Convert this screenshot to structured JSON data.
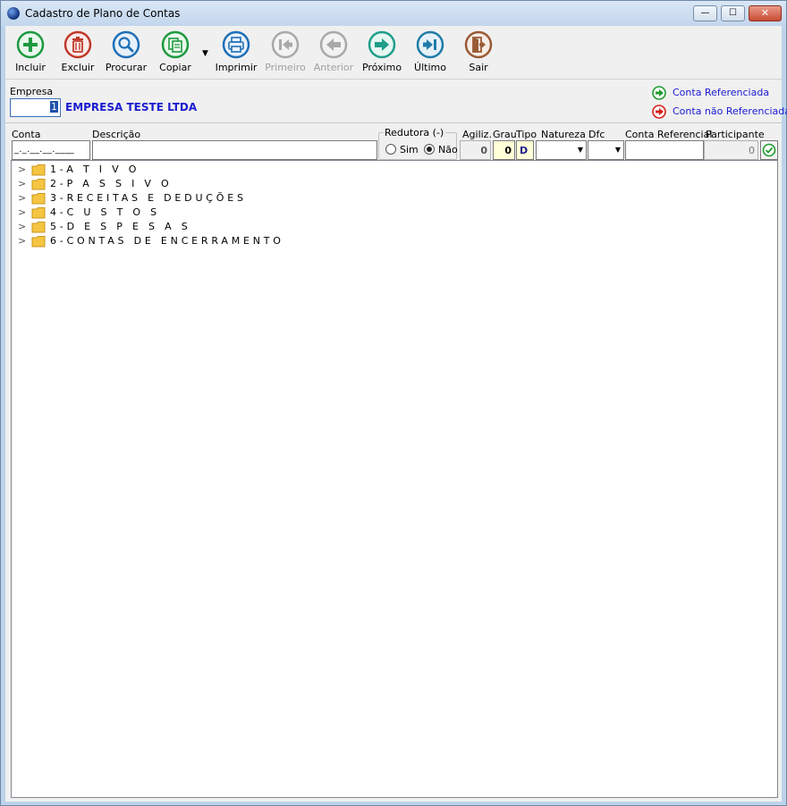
{
  "window": {
    "title": "Cadastro de Plano de Contas",
    "minimize_glyph": "—",
    "maximize_glyph": "☐",
    "close_glyph": "✕"
  },
  "toolbar": {
    "incluir": "Incluir",
    "excluir": "Excluir",
    "procurar": "Procurar",
    "copiar": "Copiar",
    "imprimir": "Imprimir",
    "primeiro": "Primeiro",
    "anterior": "Anterior",
    "proximo": "Próximo",
    "ultimo": "Último",
    "sair": "Sair",
    "dropdown_glyph": "▼"
  },
  "empresa": {
    "label": "Empresa",
    "code": "1",
    "name": "EMPRESA TESTE LTDA"
  },
  "legend": {
    "referenciada": "Conta Referenciada",
    "nao_referenciada": "Conta não Referenciada",
    "referenciada_color": "#1f9b2f",
    "nao_referenciada_color": "#d6201a"
  },
  "filters": {
    "conta_label": "Conta",
    "conta_mask": "_._.__.__.____",
    "descricao_label": "Descrição",
    "redutora_label": "Redutora (-)",
    "sim_label": "Sim",
    "nao_label": "Não",
    "agiliz_label": "Agiliz.",
    "agiliz_value": "0",
    "grau_label": "Grau",
    "grau_value": "0",
    "tipo_label": "Tipo",
    "tipo_value": "D",
    "natureza_label": "Natureza",
    "dfc_label": "Dfc",
    "conta_ref_label": "Conta Referencial",
    "participante_label": "Participante",
    "participante_value": "0"
  },
  "tree": {
    "items": [
      {
        "label": "1-A T I V O"
      },
      {
        "label": "2-P A S S I V O"
      },
      {
        "label": "3-RECEITAS E DEDUÇÕES"
      },
      {
        "label": "4-C U S T O S"
      },
      {
        "label": "5-D E S P E S A S"
      },
      {
        "label": "6-CONTAS DE ENCERRAMENTO"
      }
    ]
  }
}
